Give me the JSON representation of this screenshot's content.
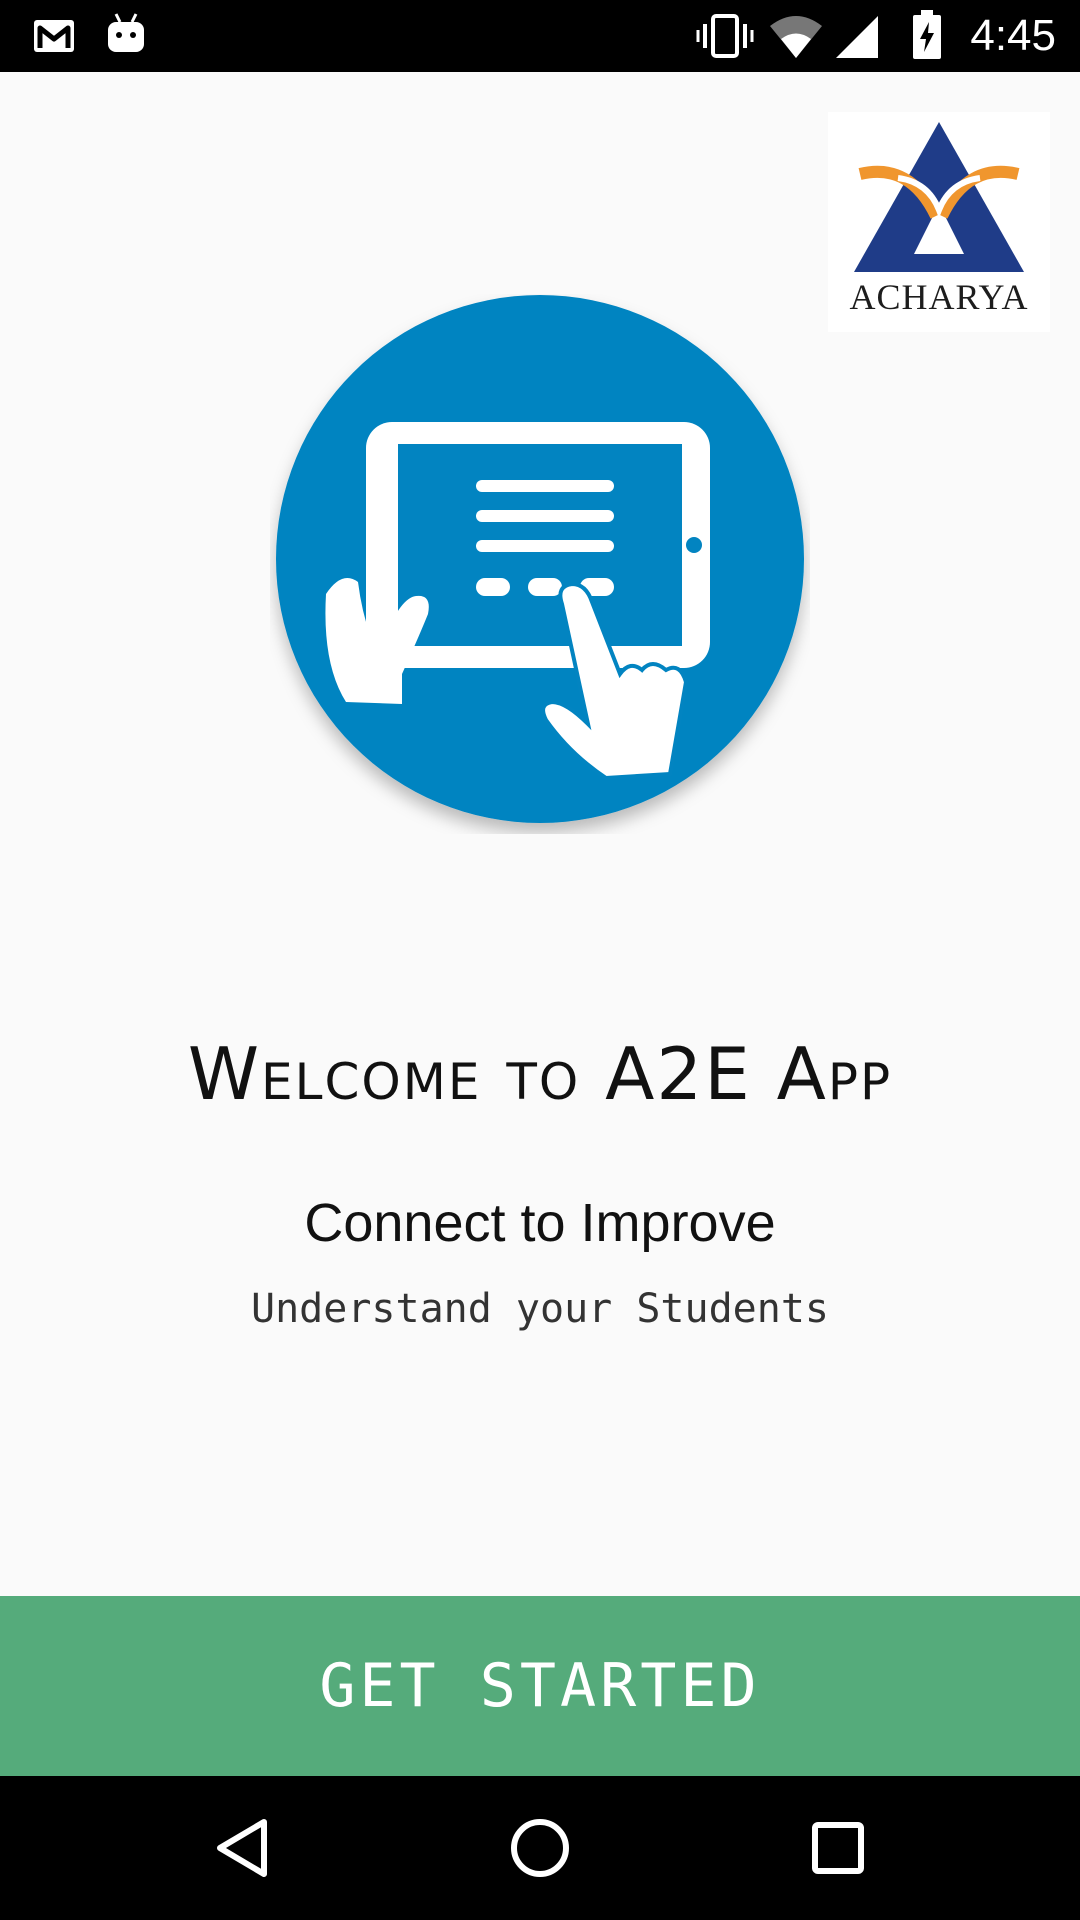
{
  "status_bar": {
    "time": "4:45",
    "left_icons": [
      "gmail-icon",
      "android-debug-icon"
    ],
    "right_icons": [
      "vibrate-icon",
      "wifi-icon",
      "cell-signal-icon",
      "battery-charging-icon"
    ]
  },
  "logo": {
    "text": "ACHARYA",
    "colors": {
      "triangle": "#1f3c88",
      "arcs": "#f0962e"
    }
  },
  "hero": {
    "icon": "tablet-touch-icon",
    "color": "#0284c1"
  },
  "welcome_title": "Welcome to A2E App",
  "tagline": "Connect to Improve",
  "subtitle": "Understand your Students",
  "cta": {
    "label": "GET STARTED",
    "color": "#55ab7b"
  },
  "nav_bar": {
    "buttons": [
      "back-icon",
      "home-icon",
      "recents-icon"
    ]
  }
}
